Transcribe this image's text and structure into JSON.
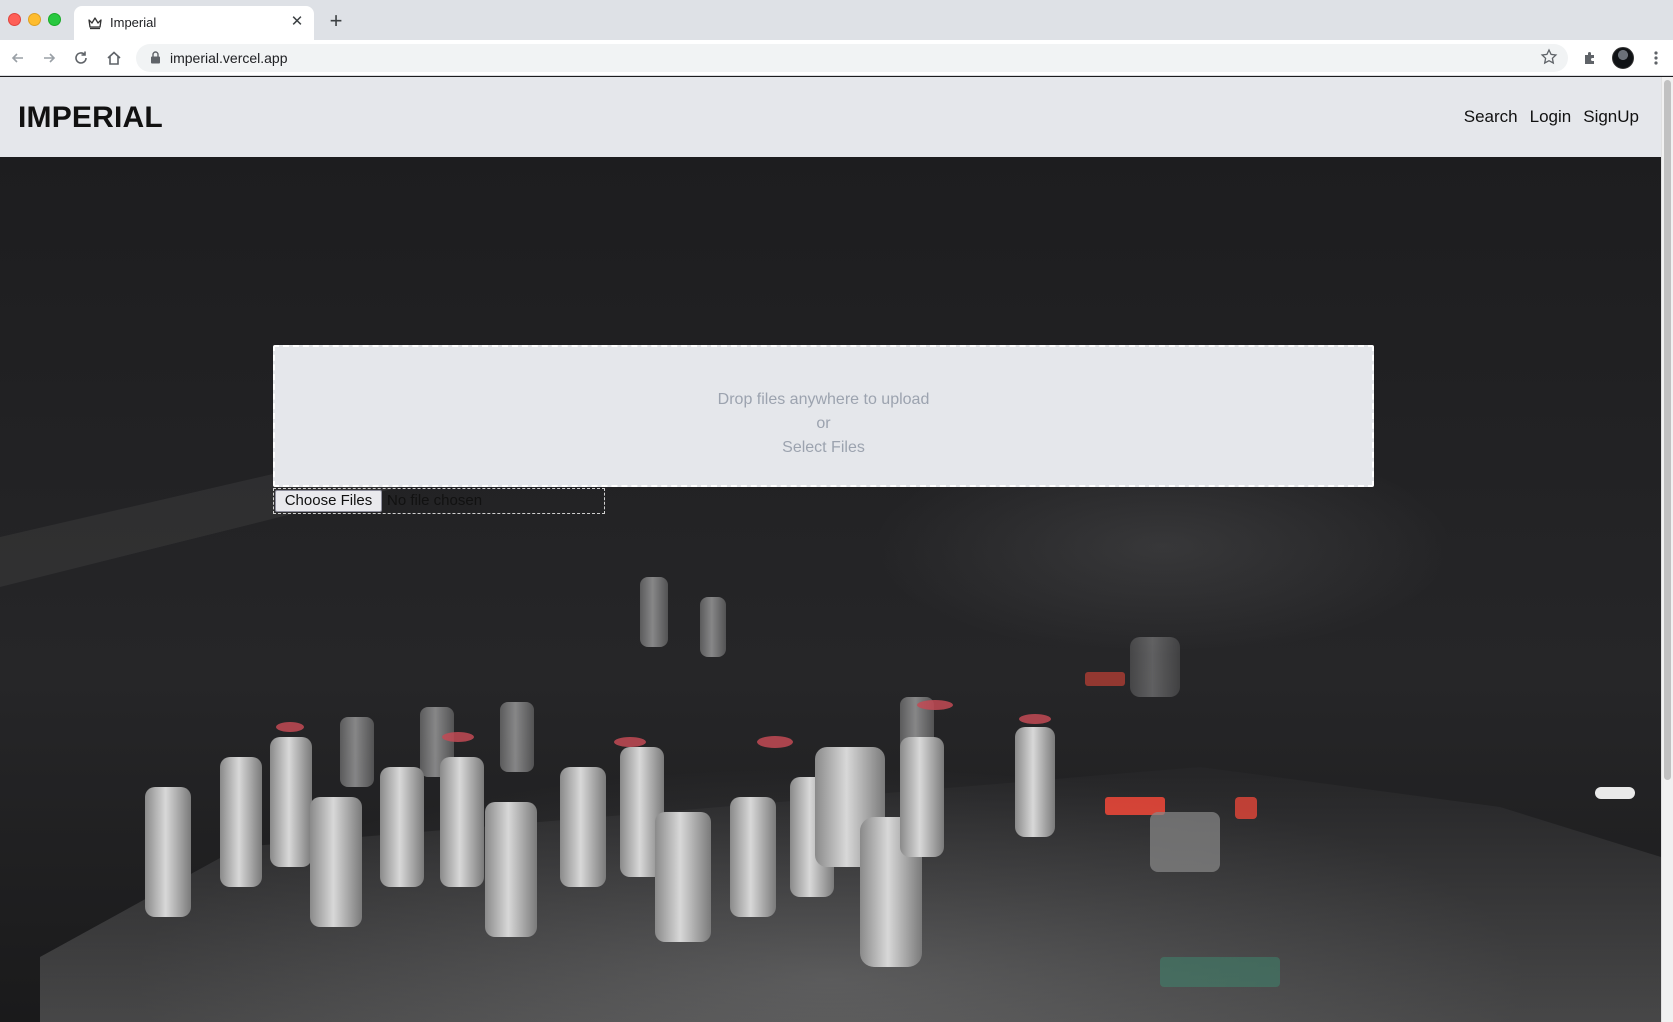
{
  "browser": {
    "tab_title": "Imperial",
    "url": "imperial.vercel.app"
  },
  "site": {
    "brand": "IMPERIAL",
    "nav": [
      "Search",
      "Login",
      "SignUp"
    ]
  },
  "upload": {
    "drop_text": "Drop files anywhere to upload",
    "or_text": "or",
    "select_text": "Select Files",
    "choose_button": "Choose Files",
    "no_file_text": "No file chosen"
  },
  "colors": {
    "navbar_bg": "#e5e7eb",
    "dropzone_bg": "#e5e7eb",
    "dropzone_text": "#9ca3af"
  }
}
